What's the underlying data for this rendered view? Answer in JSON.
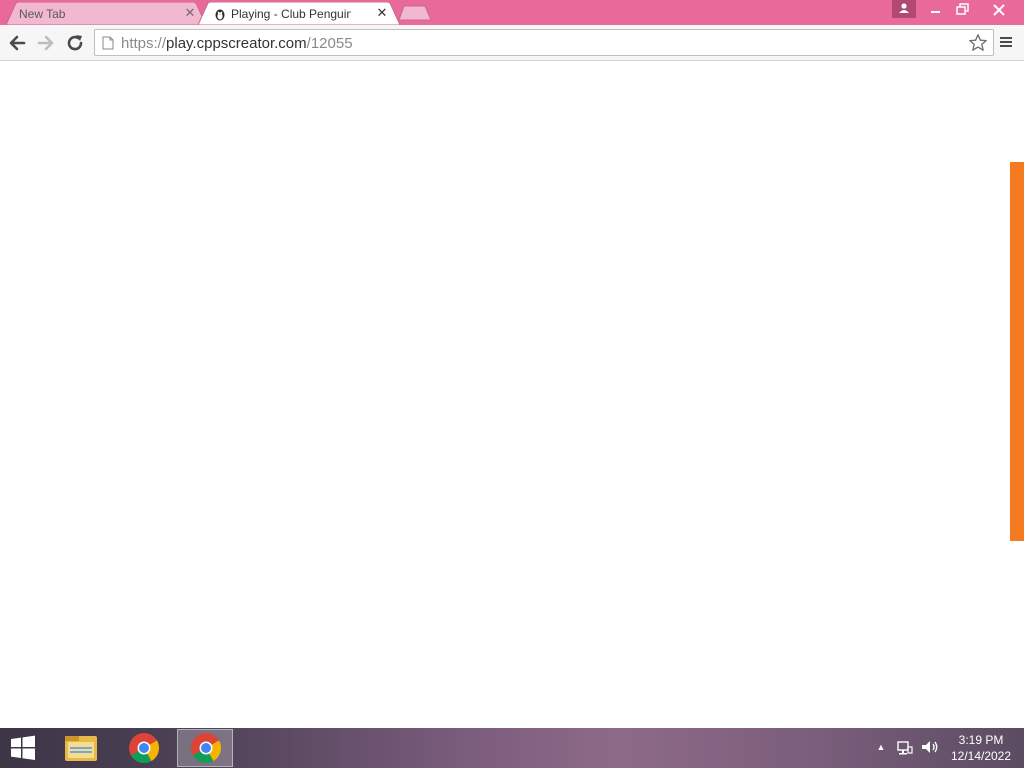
{
  "tabs": [
    {
      "label": "New Tab"
    },
    {
      "label": "Playing - Club Penguin"
    }
  ],
  "address_bar": {
    "scheme": "https://",
    "host": "play.cppscreator.com",
    "path": "/12055"
  },
  "accent_color": "#f47a20",
  "titlebar_color": "#e8699a",
  "taskbar": {
    "apps": [
      "file-explorer",
      "chrome",
      "chrome-active"
    ],
    "clock_time": "3:19 PM",
    "clock_date": "12/14/2022"
  }
}
